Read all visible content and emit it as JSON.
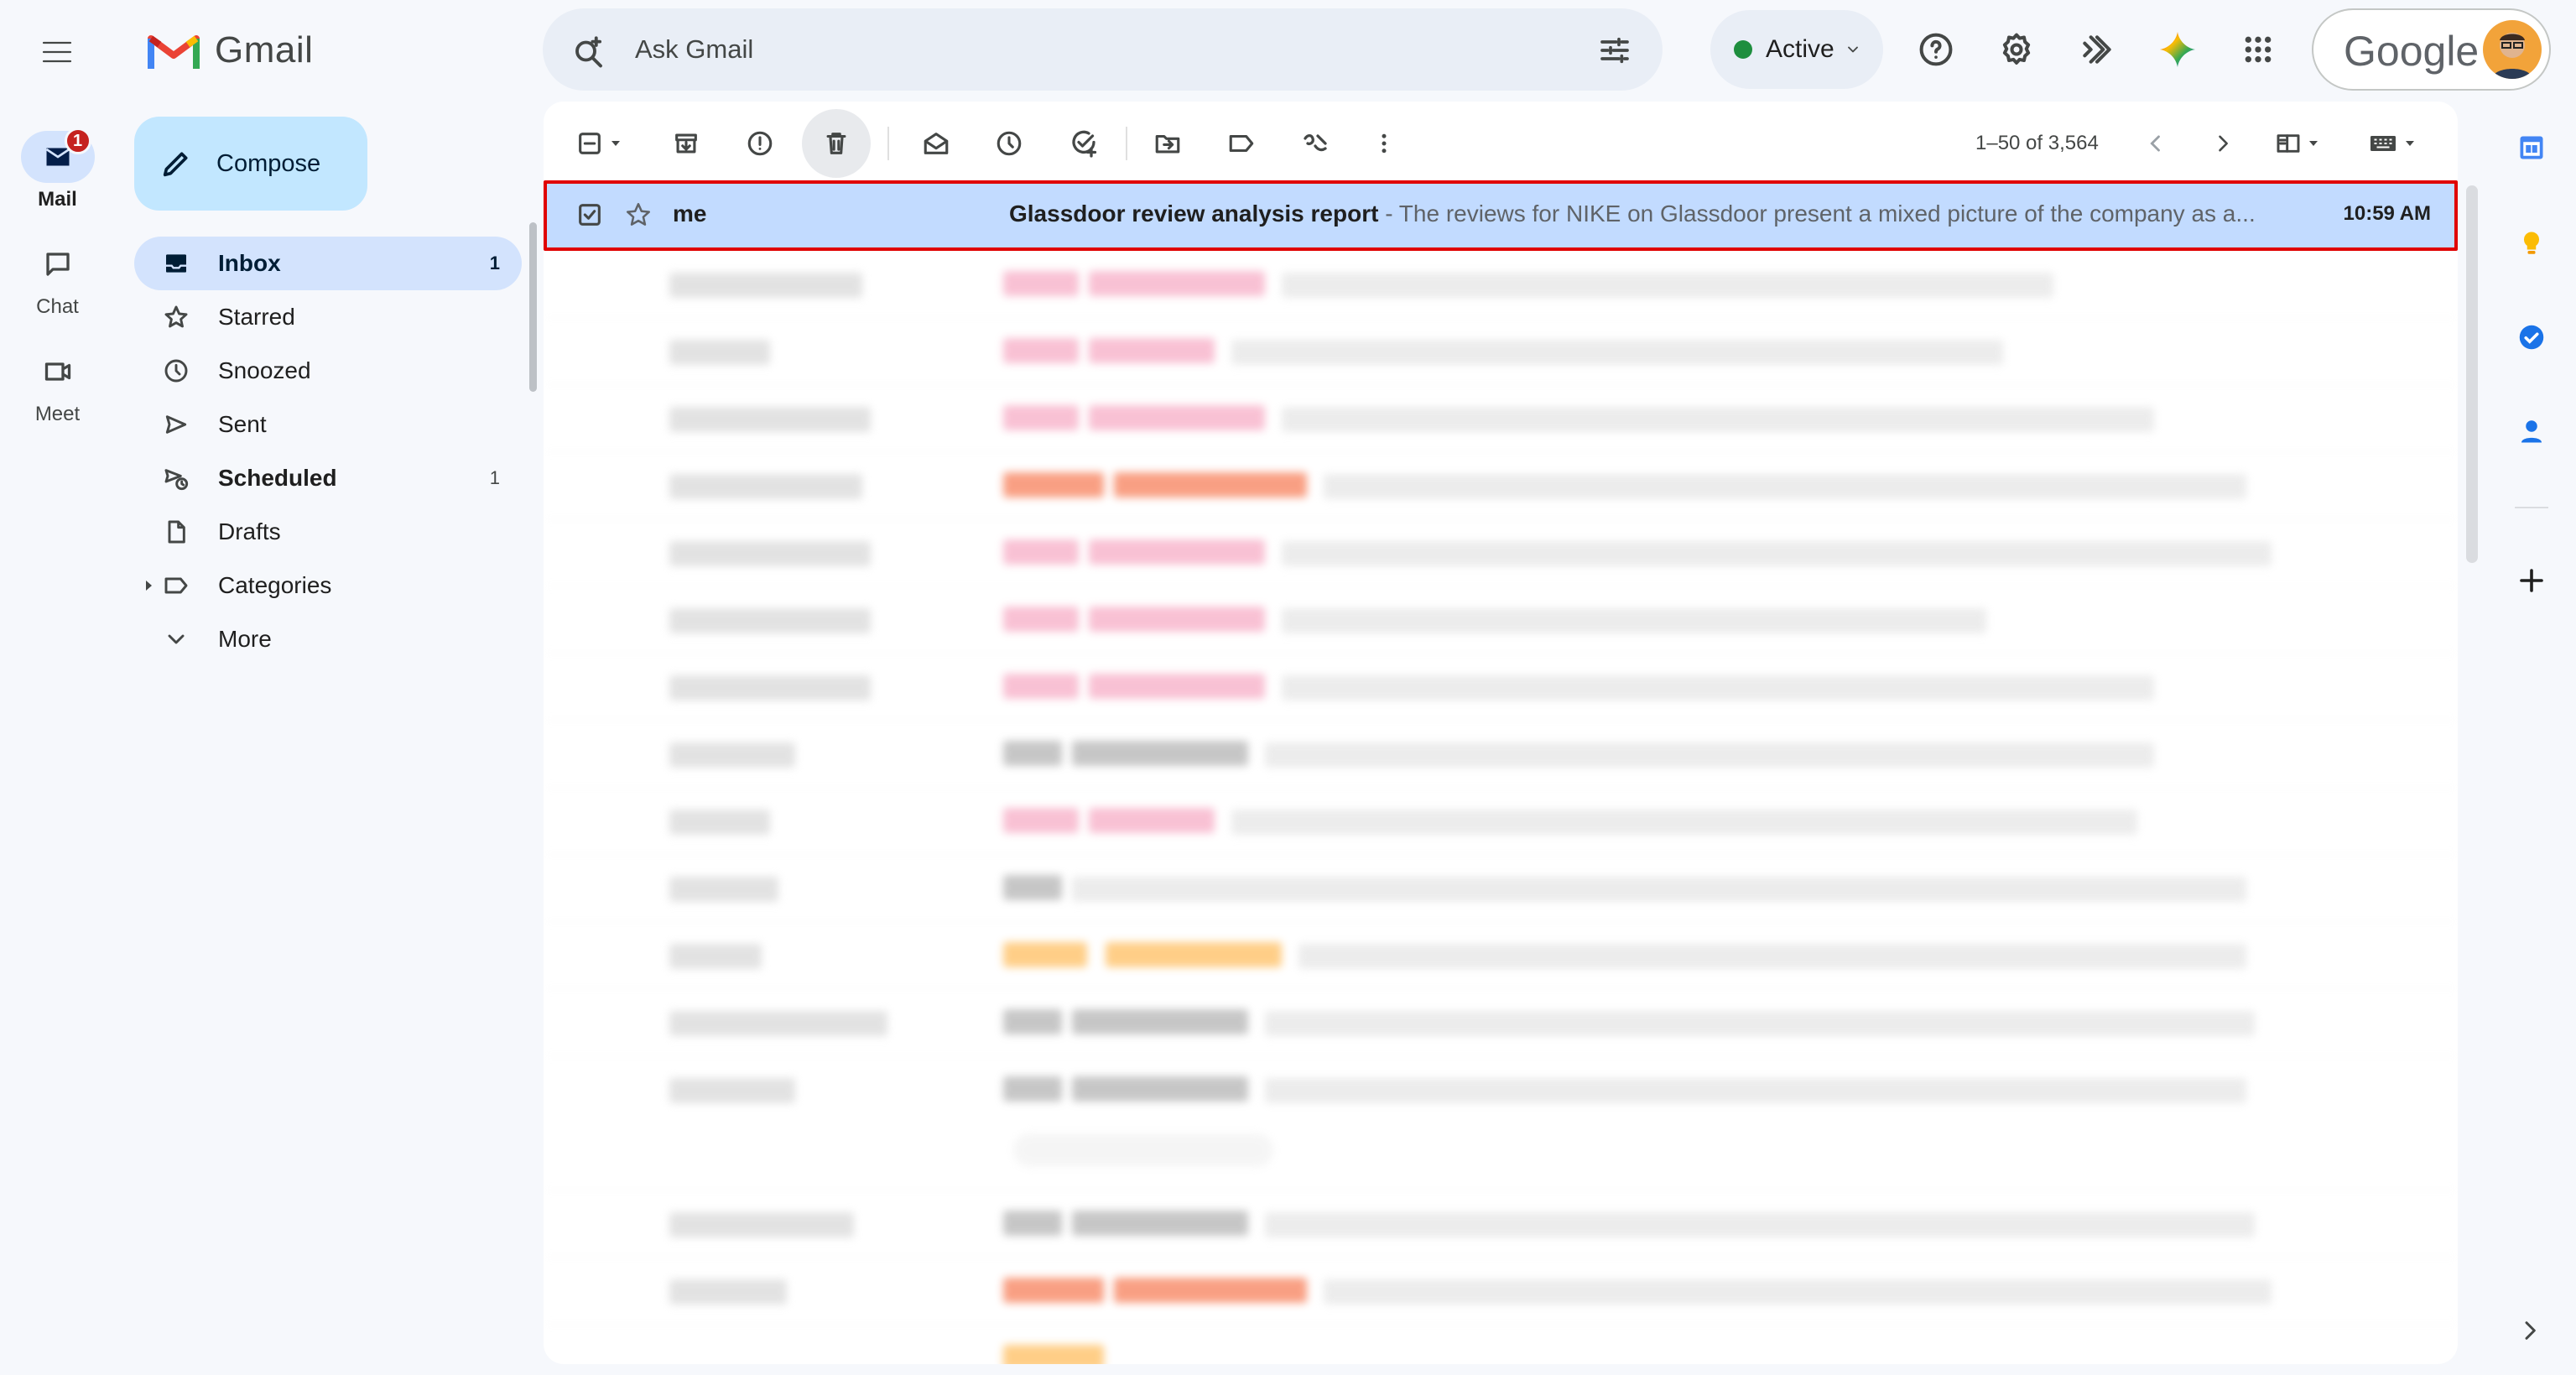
{
  "app": {
    "logo_text": "Gmail",
    "google_text": "Google"
  },
  "rail": [
    {
      "label": "Mail",
      "icon": "mail-icon",
      "badge": "1",
      "active": true
    },
    {
      "label": "Chat",
      "icon": "chat-icon"
    },
    {
      "label": "Meet",
      "icon": "meet-icon"
    }
  ],
  "search": {
    "placeholder": "Ask Gmail"
  },
  "status": {
    "label": "Active",
    "color": "#1e8e3e"
  },
  "compose": {
    "label": "Compose"
  },
  "nav": [
    {
      "label": "Inbox",
      "count": "1",
      "icon": "inbox-icon",
      "selected": true
    },
    {
      "label": "Starred",
      "count": "",
      "icon": "star-icon"
    },
    {
      "label": "Snoozed",
      "count": "",
      "icon": "clock-icon"
    },
    {
      "label": "Sent",
      "count": "",
      "icon": "send-icon"
    },
    {
      "label": "Scheduled",
      "count": "1",
      "icon": "scheduled-icon",
      "bold": true
    },
    {
      "label": "Drafts",
      "count": "",
      "icon": "draft-icon"
    },
    {
      "label": "Categories",
      "count": "",
      "icon": "label-icon"
    },
    {
      "label": "More",
      "count": "",
      "icon": "chevron-down-icon"
    }
  ],
  "toolbar": {
    "pagination": "1–50 of 3,564"
  },
  "selected_email": {
    "sender": "me",
    "subject": "Glassdoor review analysis report",
    "snippet": " - The reviews for NIKE on Glassdoor present a mixed picture of the company as a...",
    "time": "10:59 AM"
  },
  "colors": {
    "accent": "#c2e7ff",
    "selected_nav": "#d3e3fd",
    "selected_row": "#c2dbff",
    "highlight_border": "#e00000"
  }
}
